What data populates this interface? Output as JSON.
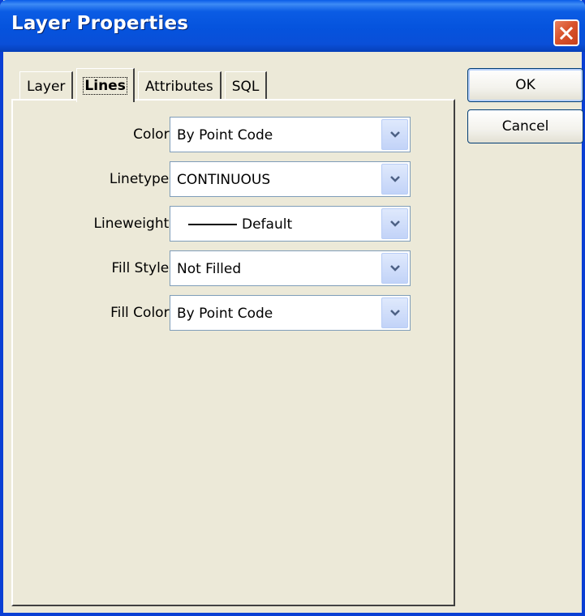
{
  "window": {
    "title": "Layer Properties"
  },
  "tabs": [
    {
      "label": "Layer",
      "active": false
    },
    {
      "label": "Lines",
      "active": true
    },
    {
      "label": "Attributes",
      "active": false
    },
    {
      "label": "SQL",
      "active": false
    }
  ],
  "fields": {
    "color": {
      "label": "Color:",
      "value": "By Point Code"
    },
    "linetype": {
      "label": "Linetype:",
      "value": "CONTINUOUS"
    },
    "lineweight": {
      "label": "Lineweight:",
      "value": "Default"
    },
    "fill_style": {
      "label": "Fill Style:",
      "value": "Not Filled"
    },
    "fill_color": {
      "label": "Fill Color:",
      "value": "By Point Code"
    }
  },
  "buttons": {
    "ok_label": "OK",
    "cancel_label": "Cancel"
  },
  "icons": {
    "close": "close-icon",
    "dropdown": "chevron-down-icon"
  },
  "colors": {
    "titlebar": "#0553dd",
    "window_bg": "#ece9d8",
    "close_button": "#d9532c",
    "combo_border": "#7f9db9"
  }
}
